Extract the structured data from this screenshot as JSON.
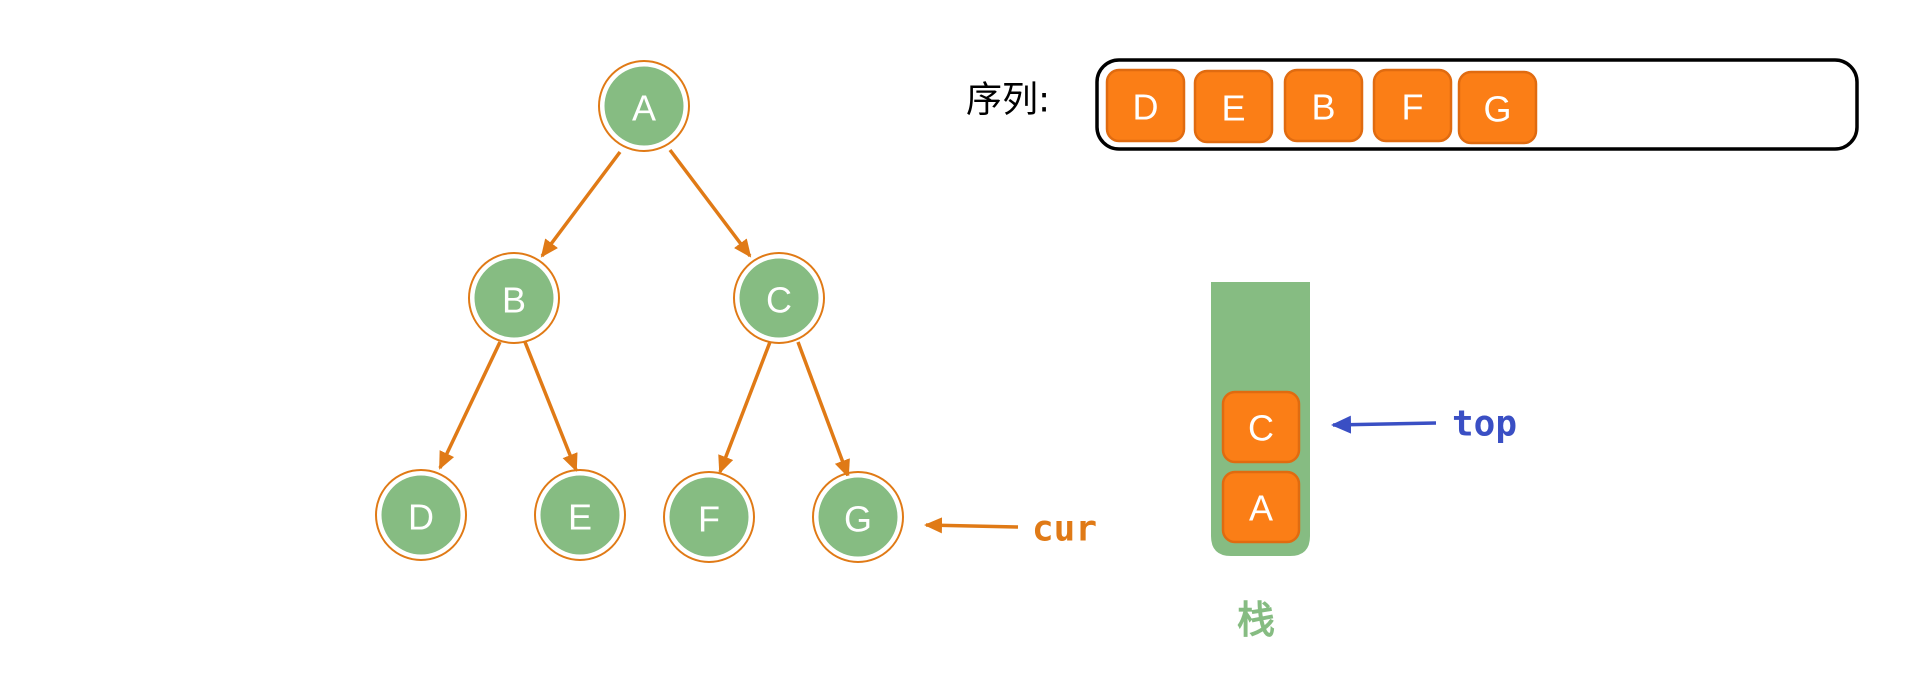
{
  "tree": {
    "nodes": [
      {
        "id": "A",
        "label": "A"
      },
      {
        "id": "B",
        "label": "B"
      },
      {
        "id": "C",
        "label": "C"
      },
      {
        "id": "D",
        "label": "D"
      },
      {
        "id": "E",
        "label": "E"
      },
      {
        "id": "F",
        "label": "F"
      },
      {
        "id": "G",
        "label": "G"
      }
    ],
    "edges": [
      {
        "from": "A",
        "to": "B"
      },
      {
        "from": "A",
        "to": "C"
      },
      {
        "from": "B",
        "to": "D"
      },
      {
        "from": "B",
        "to": "E"
      },
      {
        "from": "C",
        "to": "F"
      },
      {
        "from": "C",
        "to": "G"
      }
    ]
  },
  "sequence": {
    "label": "序列:",
    "items": [
      "D",
      "E",
      "B",
      "F",
      "G"
    ]
  },
  "stack": {
    "label": "栈",
    "items_bottom_to_top": [
      "A",
      "C"
    ]
  },
  "pointers": {
    "cur": {
      "label": "cur",
      "target": "G",
      "color": "#e07a16"
    },
    "top": {
      "label": "top",
      "target": "C",
      "color": "#3a4fc4"
    }
  },
  "colors": {
    "node_fill": "#86bc82",
    "node_ring": "#e07a16",
    "edge": "#e07a16",
    "box_fill": "#fb7e16",
    "stack_fill": "#86bc82"
  }
}
